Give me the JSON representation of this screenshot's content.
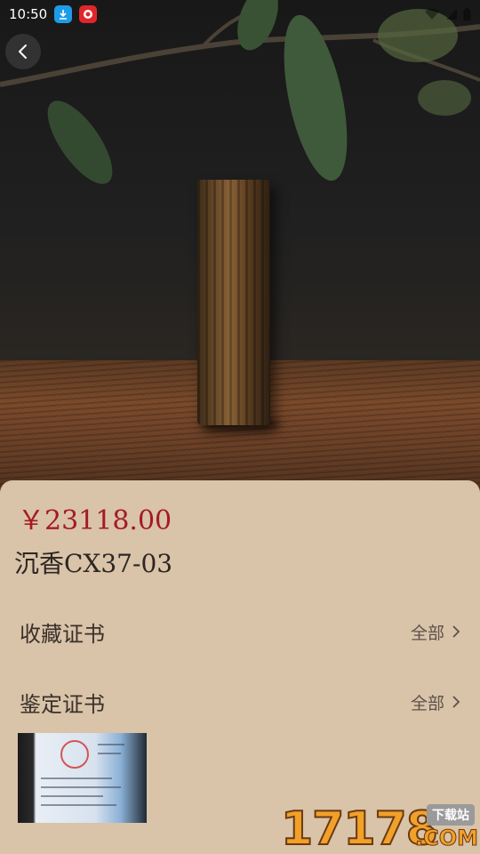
{
  "status_bar": {
    "time": "10:50",
    "icons": [
      "download-icon",
      "app-notification-icon",
      "wifi-icon",
      "signal-icon",
      "battery-icon"
    ]
  },
  "hero": {
    "subject": "agarwood-block-photo",
    "icons": [
      "back-arrow-icon"
    ]
  },
  "product": {
    "price": "￥23118.00",
    "title": "沉香CX37-03"
  },
  "sections": {
    "collection_cert": {
      "label": "收藏证书",
      "more": "全部"
    },
    "appraisal_cert": {
      "label": "鉴定证书",
      "more": "全部"
    }
  },
  "watermark": {
    "number": "17178",
    "tag": "下载站",
    "suffix": ".COM"
  },
  "colors": {
    "price": "#a41b22",
    "sheet_bg": "#d9c3a9",
    "title": "#2d2622",
    "label": "#3a302a",
    "more": "#5c524a"
  }
}
